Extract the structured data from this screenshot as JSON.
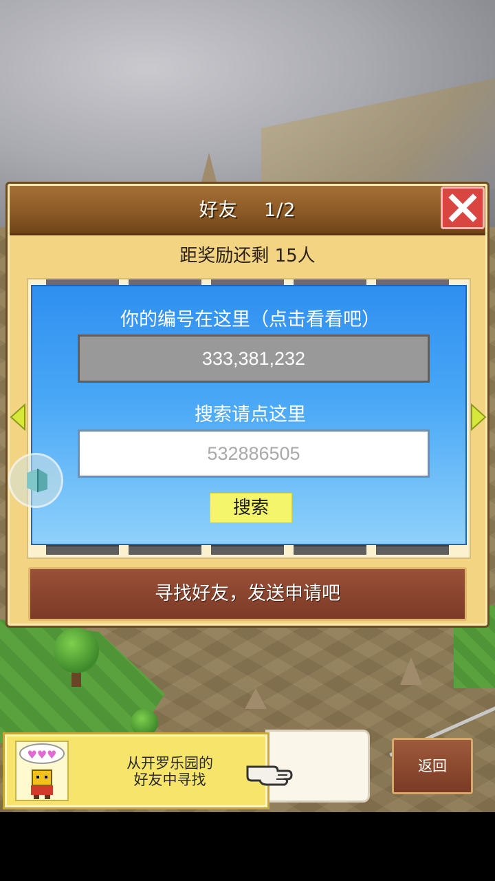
{
  "dialog": {
    "title": "好友    1/2",
    "reward_text": "距奖励还剩 15人",
    "id_label": "你的编号在这里（点击看看吧）",
    "id_value": "333,381,232",
    "search_label": "搜索请点这里",
    "search_placeholder": "532886505",
    "search_button": "搜索",
    "send_request_button": "寻找好友，发送申请吧"
  },
  "bottom_bar": {
    "kairo_line1": "从开罗乐园的",
    "kairo_line2": "好友中寻找",
    "back_button": "返回"
  },
  "icons": {
    "close": "close-icon",
    "prev": "arrow-left-icon",
    "next": "arrow-right-icon",
    "view": "cube-view-icon",
    "kairo": "kairo-character-icon",
    "pointer": "pointing-hand-icon"
  },
  "colors": {
    "title_bar": "#8c5a26",
    "close_button": "#d94540",
    "panel_blue": "#2f8ff0",
    "search_button": "#f4f56a",
    "send_button": "#7c3a26",
    "kairo_button": "#f7e56b"
  }
}
